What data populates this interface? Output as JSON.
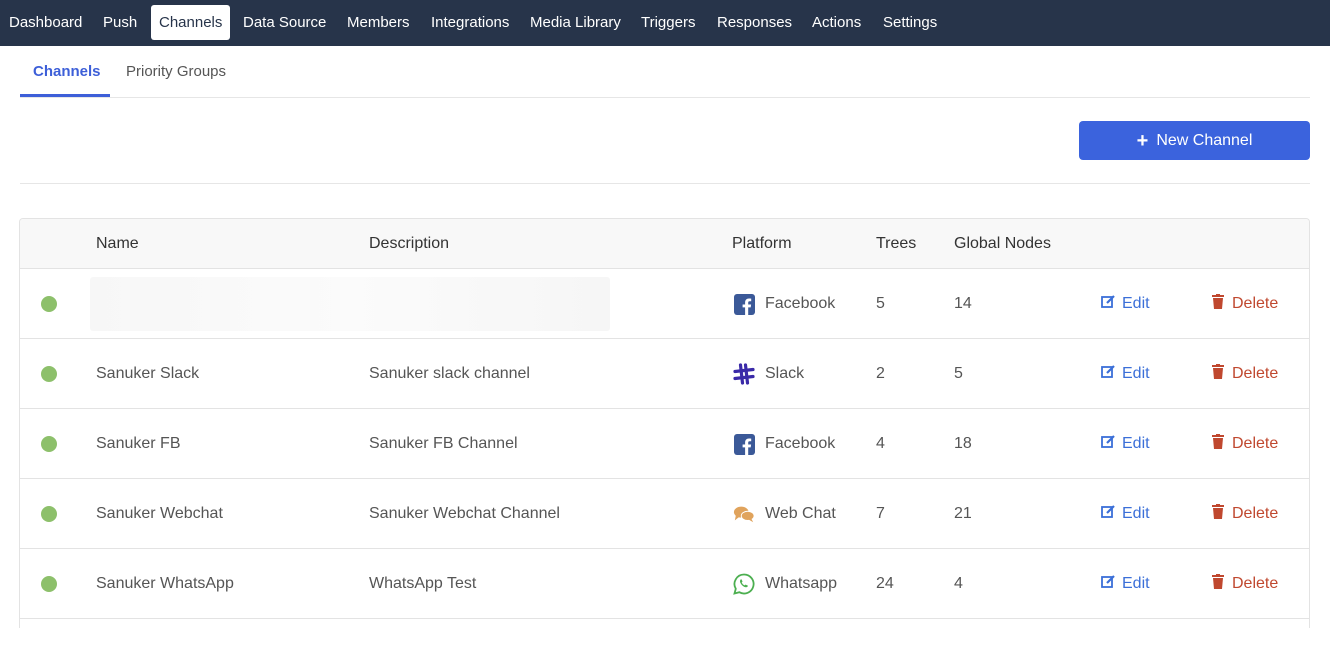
{
  "topnav": {
    "items": [
      "Dashboard",
      "Push",
      "Channels",
      "Data Source",
      "Members",
      "Integrations",
      "Media Library",
      "Triggers",
      "Responses",
      "Actions",
      "Settings"
    ],
    "active": "Channels"
  },
  "subtabs": {
    "channels": "Channels",
    "priority_groups": "Priority Groups"
  },
  "toolbar": {
    "new_channel_label": "New Channel"
  },
  "table": {
    "headers": {
      "name": "Name",
      "description": "Description",
      "platform": "Platform",
      "trees": "Trees",
      "global_nodes": "Global Nodes"
    },
    "rows": [
      {
        "name": "",
        "description": "",
        "platform": "Facebook",
        "platform_icon": "facebook-icon",
        "trees": "5",
        "global_nodes": "14",
        "edit": "Edit",
        "delete": "Delete"
      },
      {
        "name": "Sanuker Slack",
        "description": "Sanuker slack channel",
        "platform": "Slack",
        "platform_icon": "slack-icon",
        "trees": "2",
        "global_nodes": "5",
        "edit": "Edit",
        "delete": "Delete"
      },
      {
        "name": "Sanuker FB",
        "description": "Sanuker FB Channel",
        "platform": "Facebook",
        "platform_icon": "facebook-icon",
        "trees": "4",
        "global_nodes": "18",
        "edit": "Edit",
        "delete": "Delete"
      },
      {
        "name": "Sanuker Webchat",
        "description": "Sanuker Webchat Channel",
        "platform": "Web Chat",
        "platform_icon": "webchat-icon",
        "trees": "7",
        "global_nodes": "21",
        "edit": "Edit",
        "delete": "Delete"
      },
      {
        "name": "Sanuker WhatsApp",
        "description": "WhatsApp Test",
        "platform": "Whatsapp",
        "platform_icon": "whatsapp-icon",
        "trees": "24",
        "global_nodes": "4",
        "edit": "Edit",
        "delete": "Delete"
      }
    ]
  },
  "colors": {
    "nav_bg": "#27344a",
    "accent": "#3b63dd",
    "status_active": "#8dc06b",
    "edit": "#3b6fd8",
    "delete": "#c0482f"
  }
}
